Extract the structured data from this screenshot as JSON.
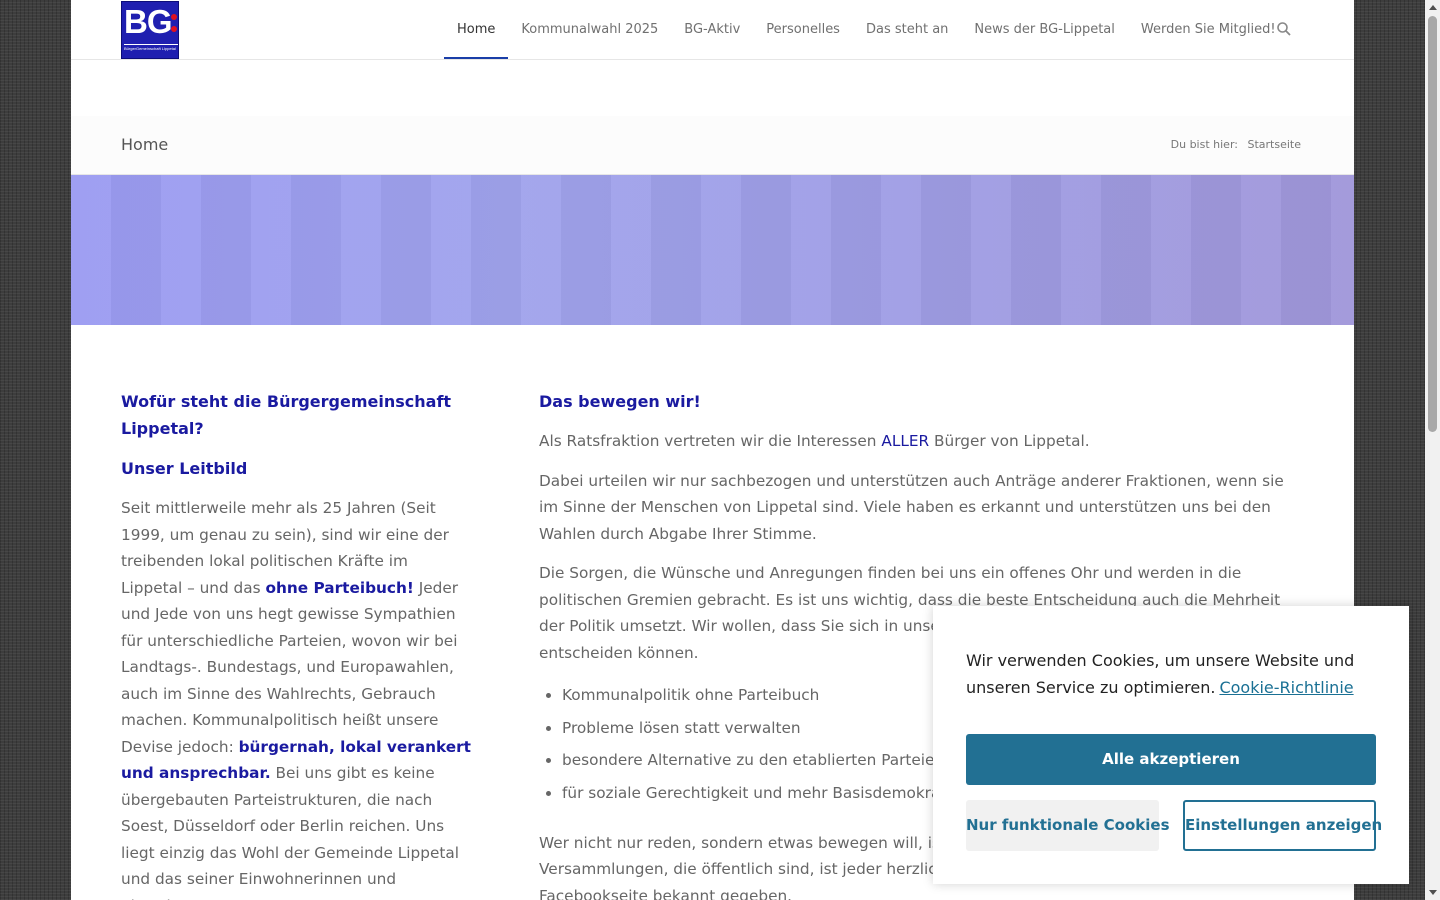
{
  "logo": {
    "text": "BG",
    "subtitle": "BürgerGemeinschaft Lippetal"
  },
  "nav": {
    "items": [
      "Home",
      "Kommunalwahl 2025",
      "BG-Aktiv",
      "Personelles",
      "Das steht an",
      "News der BG-Lippetal",
      "Werden Sie Mitglied!"
    ],
    "active": "Home",
    "search_icon": "search-icon"
  },
  "titlebar": {
    "title": "Home",
    "breadcrumb_label": "Du bist hier:",
    "breadcrumb_link": "Startseite"
  },
  "left": {
    "heading1": "Wofür steht die Bürgergemeinschaft Lippetal?",
    "heading2": "Unser Leitbild",
    "p1_a": "Seit mittlerweile mehr als 25 Jahren (Seit 1999, um genau zu sein), sind wir eine der treibenden lokal politischen Kräfte im Lippetal – und das ",
    "p1_hl1": "ohne Parteibuch!",
    "p1_b": " Jeder und Jede von uns hegt gewisse Sympathien für unterschiedliche Parteien, wovon wir bei Landtags-. Bundestags, und Europawahlen, auch im Sinne des Wahlrechts, Gebrauch machen. Kommunalpolitisch heißt unsere Devise jedoch: ",
    "p1_hl2": "bürgernah, lokal verankert und ansprechbar.",
    "p1_c": " Bei uns gibt es keine übergebauten Parteistrukturen, die nach Soest, Düsseldorf oder Berlin reichen. Uns liegt einzig das Wohl der Gemeinde Lippetal und das seiner Einwohnerinnen und Einwohner am Herzen."
  },
  "right": {
    "heading": "Das bewegen wir!",
    "p1_a": "Als Ratsfraktion vertreten wir die Interessen ",
    "p1_hl": "ALLER",
    "p1_b": " Bürger von Lippetal.",
    "p2": "Dabei urteilen wir nur sachbezogen und unterstützen auch Anträge anderer Fraktionen, wenn sie im Sinne der Menschen von Lippetal sind. Viele haben es erkannt und unterstützen uns bei den Wahlen durch Abgabe Ihrer Stimme.",
    "p3": "Die Sorgen, die Wünsche und Anregungen finden bei uns ein offenes Ohr und werden in die politischen Gremien gebracht. Es ist uns wichtig, dass die beste Entscheidung auch die Mehrheit der Politik umsetzt. Wir wollen, dass Sie sich in unserer Gemeinde wohlfühlen und für Lippetal entscheiden können.",
    "list": [
      "Kommunalpolitik ohne Parteibuch",
      "Probleme lösen statt verwalten",
      "besondere Alternative zu den etablierten Parteien",
      "für soziale Gerechtigkeit und mehr Basisdemokratie"
    ],
    "p4": "Wer nicht nur reden, sondern etwas bewegen will, ist bei uns genau richtig. Zu unseren Versammlungen, die öffentlich sind, ist jeder herzlich eingeladen. Die Termine werden auf unserer Facebookseite bekannt gegeben."
  },
  "cookie": {
    "message": "Wir verwenden Cookies, um unsere Website und unseren Service zu optimieren.",
    "link": "Cookie-Richtlinie",
    "accept": "Alle akzeptieren",
    "functional": "Nur funktionale Cookies",
    "settings": "Einstellungen anzeigen"
  },
  "colors": {
    "accent": "#227093",
    "heading": "#1a1aa0",
    "banner": "#9b9bf2"
  }
}
